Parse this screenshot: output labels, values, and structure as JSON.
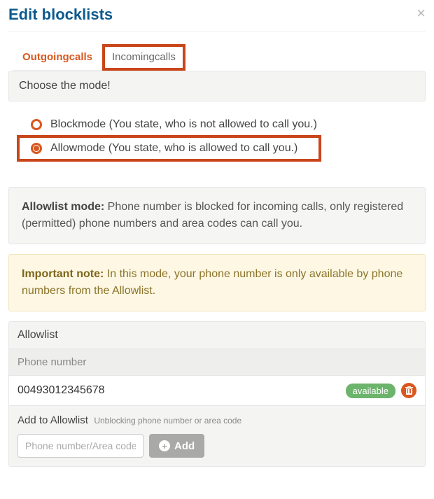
{
  "dialog": {
    "title": "Edit blocklists"
  },
  "tabs": {
    "outgoing": "Outgoingcalls",
    "incoming": "Incomingcalls",
    "active": "outgoing",
    "highlighted": "incoming"
  },
  "mode_panel": {
    "heading": "Choose the mode!"
  },
  "modes": {
    "block": "Blockmode (You state, who is not allowed to call you.)",
    "allow": "Allowmode (You state, who is allowed to call you.)",
    "selected": "allow",
    "highlighted": "allow"
  },
  "info": {
    "lead": "Allowlist mode:",
    "body": " Phone number is blocked for incoming calls, only registered (permitted) phone numbers and area codes can call you."
  },
  "note": {
    "lead": "Important note:",
    "body": " In this mode, your phone number is only available by phone numbers from the Allowlist."
  },
  "allowlist": {
    "title": "Allowlist",
    "column": "Phone number",
    "rows": [
      {
        "number": "00493012345678",
        "status": "available"
      }
    ]
  },
  "add": {
    "label": "Add to Allowlist",
    "sublabel": "Unblocking phone number or area code",
    "placeholder": "Phone number/Area code",
    "button": "Add"
  }
}
